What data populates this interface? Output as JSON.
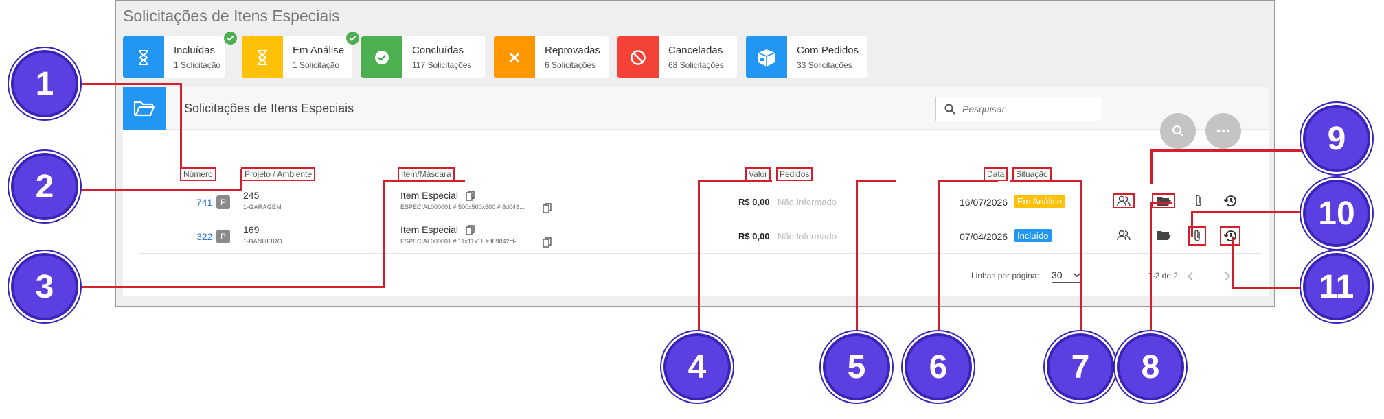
{
  "page": {
    "title": "Solicitações de Itens Especiais"
  },
  "stats": [
    {
      "label": "Incluídas",
      "count": "1 Solicitação",
      "color": "#2196f3",
      "icon": "hourglass-icon",
      "checked": true
    },
    {
      "label": "Em Análise",
      "count": "1 Solicitação",
      "color": "#ffc107",
      "icon": "hourglass-icon",
      "checked": true
    },
    {
      "label": "Concluídas",
      "count": "117 Solicitações",
      "color": "#4caf50",
      "icon": "check-circle-icon",
      "checked": false
    },
    {
      "label": "Reprovadas",
      "count": "6 Solicitações",
      "color": "#ff9800",
      "icon": "x-icon",
      "checked": false
    },
    {
      "label": "Canceladas",
      "count": "68 Solicitações",
      "color": "#f44336",
      "icon": "ban-icon",
      "checked": false
    },
    {
      "label": "Com Pedidos",
      "count": "33 Solicitações",
      "color": "#2196f3",
      "icon": "box-icon",
      "checked": false
    }
  ],
  "panel": {
    "title": "Solicitações de Itens Especiais",
    "search_placeholder": "Pesquisar"
  },
  "columns": {
    "numero": "Número",
    "projeto": "Projeto / Ambiente",
    "item": "Item/Máscara",
    "valor": "Valor",
    "pedidos": "Pedidos",
    "data": "Data",
    "situacao": "Situação"
  },
  "rows": [
    {
      "numero": "741",
      "badge": "P",
      "projeto": "245",
      "ambiente": "1-GARAGEM",
      "item": "Item Especial",
      "mascara": "ESPECIAL000001 # 500x500x500 # 8d048...",
      "valor": "R$ 0,00",
      "pedidos": "Não Informado",
      "data": "16/07/2026",
      "situacao": "Em Análise",
      "situacao_color": "#ffc107"
    },
    {
      "numero": "322",
      "badge": "P",
      "projeto": "169",
      "ambiente": "1-BANHEIRO",
      "item": "Item Especial",
      "mascara": "ESPECIAL000001 # 11x11x11 # f89842cf-...",
      "valor": "R$ 0,00",
      "pedidos": "Não Informado",
      "data": "07/04/2026",
      "situacao": "Incluído",
      "situacao_color": "#2196f3"
    }
  ],
  "pagination": {
    "rows_label": "Linhas por página:",
    "rows_per_page": "30",
    "range": "1-2 de 2"
  },
  "callouts": [
    "1",
    "2",
    "3",
    "4",
    "5",
    "6",
    "7",
    "8",
    "9",
    "10",
    "11"
  ],
  "colors": {
    "highlight": "#d61f2c",
    "callout": "#5b3fe0",
    "link": "#2c7ad6"
  }
}
